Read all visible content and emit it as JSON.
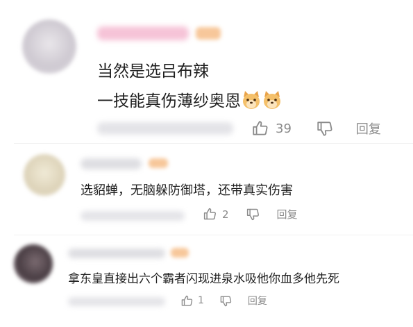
{
  "comments": [
    {
      "lines": [
        "当然是选吕布辣",
        "一技能真伤薄纱奥恩"
      ],
      "emoji": [
        "dog-face-emoji",
        "dog-face-emoji"
      ],
      "likes": "39",
      "reply_label": "回复"
    },
    {
      "lines": [
        "选貂蝉，无脑躲防御塔，还带真实伤害"
      ],
      "likes": "2",
      "reply_label": "回复"
    },
    {
      "lines": [
        "拿东皇直接出六个霸者闪现进泉水吸他你血多他先死"
      ],
      "likes": "1",
      "reply_label": "回复"
    }
  ],
  "colors": {
    "name_pink": "#f6c3d7",
    "badge_orange": "#f7c79a",
    "action_gray": "#8a8a8a"
  }
}
